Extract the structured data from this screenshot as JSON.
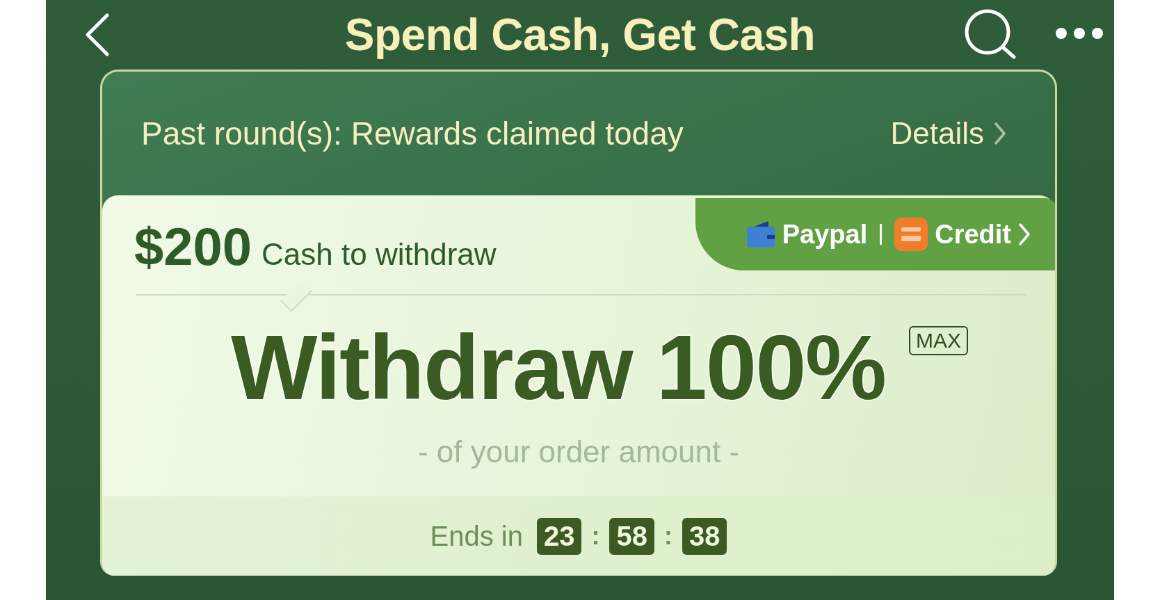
{
  "header": {
    "title": "Spend Cash, Get Cash"
  },
  "banner": {
    "text": "Past round(s): Rewards claimed today",
    "link": "Details"
  },
  "balance": {
    "amount": "$200",
    "label": "Cash to withdraw"
  },
  "methods": [
    {
      "kind": "wallet",
      "label": "Paypal"
    },
    {
      "kind": "app",
      "label": "Credit"
    }
  ],
  "offer": {
    "headline": "Withdraw 100%",
    "badge": "MAX",
    "subtitle": "- of your order amount -"
  },
  "countdown": {
    "label": "Ends in",
    "separator": ":",
    "units": [
      "23",
      "58",
      "38"
    ]
  }
}
